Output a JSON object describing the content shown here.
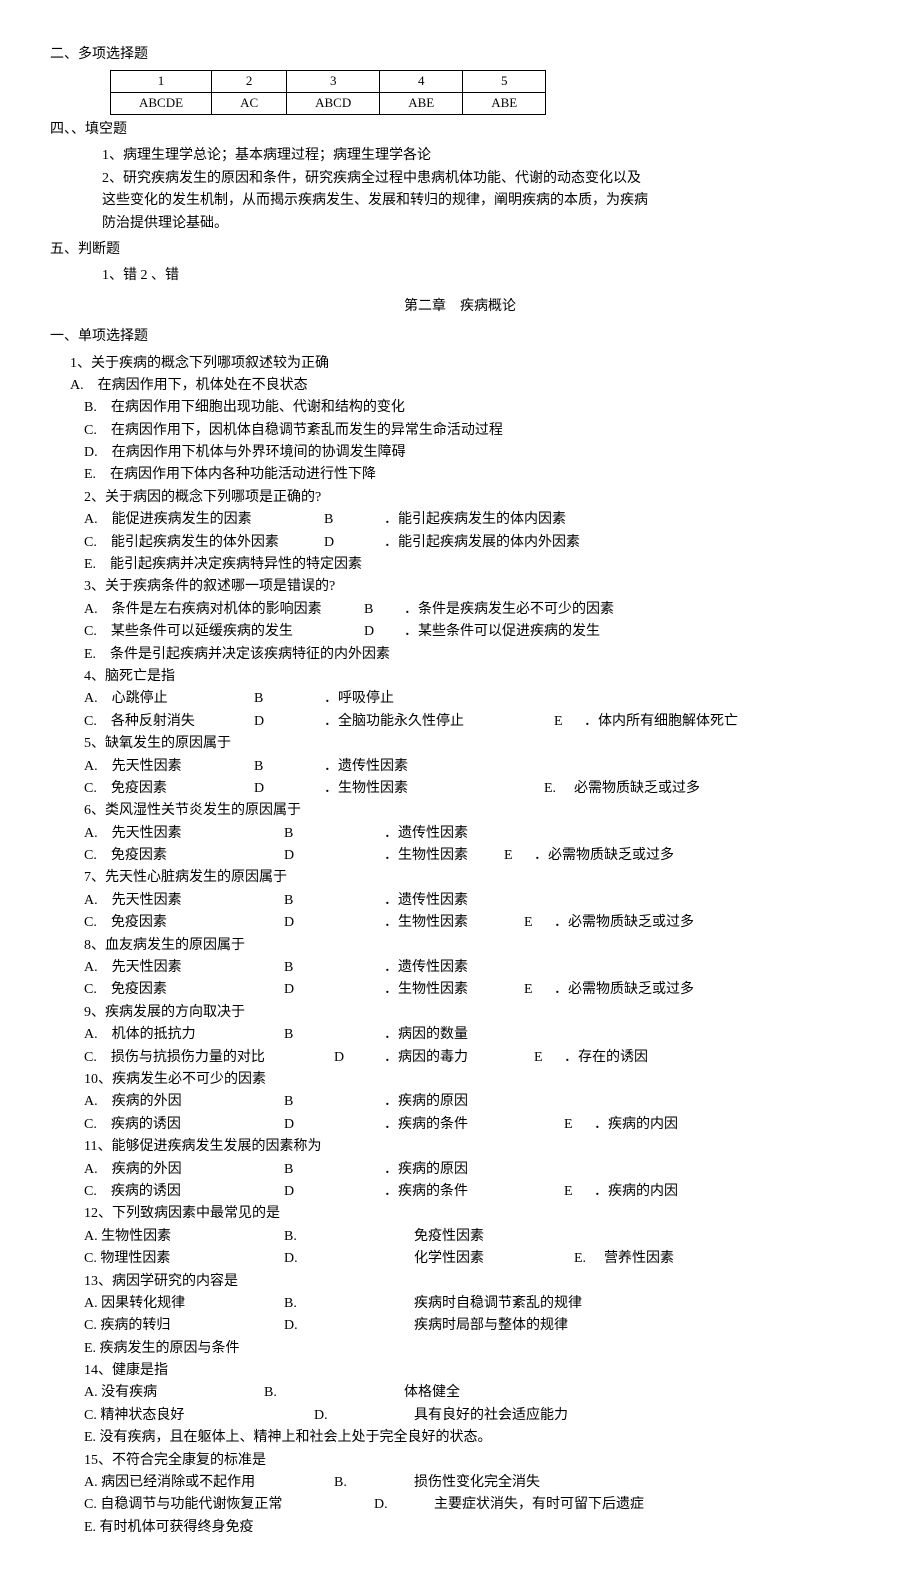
{
  "sec2_title": "二、多项选择题",
  "table": {
    "h": [
      "1",
      "2",
      "3",
      "4",
      "5"
    ],
    "r": [
      "ABCDE",
      "AC",
      "ABCD",
      "ABE",
      "ABE"
    ]
  },
  "sec4_title": "四、、填空题",
  "fill1": "1、病理生理学总论；基本病理过程；病理生理学各论",
  "fill2a": "2、研究疾病发生的原因和条件，研究疾病全过程中患病机体功能、代谢的动态变化以及",
  "fill2b": "这些变化的发生机制，从而揭示疾病发生、发展和转归的规律，阐明疾病的本质，为疾病",
  "fill2c": "防治提供理论基础。",
  "sec5_title": "五、判断题",
  "judge": "1、错  2 、错",
  "chapter": "第二章　疾病概论",
  "sec1_title": "一、单项选择题",
  "q1": {
    "stem": "1、关于疾病的概念下列哪项叙述较为正确",
    "A": "A.　在病因作用下，机体处在不良状态",
    "B": "B.　在病因作用下细胞出现功能、代谢和结构的变化",
    "C": "C.　在病因作用下，因机体自稳调节紊乱而发生的异常生命活动过程",
    "D": "D.　在病因作用下机体与外界环境间的协调发生障碍",
    "E": "E.　在病因作用下体内各种功能活动进行性下降"
  },
  "q2": {
    "stem": "2、关于病因的概念下列哪项是正确的?",
    "A": "A.　能促进疾病发生的因素",
    "Blabel": "B",
    "B": "．能引起疾病发生的体内因素",
    "C": "C.　能引起疾病发生的体外因素",
    "Dlabel": "D",
    "D": "．能引起疾病发展的体内外因素",
    "E": "E.　能引起疾病并决定疾病特异性的特定因素"
  },
  "q3": {
    "stem": "3、关于疾病条件的叙述哪一项是错误的?",
    "A": "A.　条件是左右疾病对机体的影响因素",
    "Blabel": "B",
    "B": "．条件是疾病发生必不可少的因素",
    "C": "C.　某些条件可以延缓疾病的发生",
    "Dlabel": "D",
    "D": "．某些条件可以促进疾病的发生",
    "E": "E.　条件是引起疾病并决定该疾病特征的内外因素"
  },
  "q4": {
    "stem": "4、脑死亡是指",
    "A": "A.　心跳停止",
    "Bl": "B",
    "B": "．呼吸停止",
    "C": "C.　各种反射消失",
    "Dl": "D",
    "D": "．全脑功能永久性停止",
    "El": "E",
    "E": "．体内所有细胞解体死亡"
  },
  "q5": {
    "stem": "5、缺氧发生的原因属于",
    "A": "A.　先天性因素",
    "Bl": "B",
    "B": "．遗传性因素",
    "C": "C.　免疫因素",
    "Dl": "D",
    "D": "．生物性因素",
    "El": "E.",
    "E": "必需物质缺乏或过多"
  },
  "q6": {
    "stem": "6、类风湿性关节炎发生的原因属于",
    "A": "A.　先天性因素",
    "Bl": "B",
    "B": "．遗传性因素",
    "C": "C.　免疫因素",
    "Dl": "D",
    "D": "．生物性因素",
    "El": "E",
    "E": "．必需物质缺乏或过多"
  },
  "q7": {
    "stem": "7、先天性心脏病发生的原因属于",
    "A": "A.　先天性因素",
    "Bl": "B",
    "B": "．遗传性因素",
    "C": "C.　免疫因素",
    "Dl": "D",
    "D": "．生物性因素",
    "El": "E",
    "E": "．必需物质缺乏或过多"
  },
  "q8": {
    "stem": "8、血友病发生的原因属于",
    "A": "A.　先天性因素",
    "Bl": "B",
    "B": "．遗传性因素",
    "C": "C.　免疫因素",
    "Dl": "D",
    "D": "．生物性因素",
    "El": "E",
    "E": "．必需物质缺乏或过多"
  },
  "q9": {
    "stem": "9、疾病发展的方向取决于",
    "A": "A.　机体的抵抗力",
    "Bl": "B",
    "B": "．病因的数量",
    "C": "C.　损伤与抗损伤力量的对比",
    "Dl": "D",
    "D": "．病因的毒力",
    "El": "E",
    "E": "．存在的诱因"
  },
  "q10": {
    "stem": "10、疾病发生必不可少的因素",
    "A": "A.　疾病的外因",
    "Bl": "B",
    "B": "．疾病的原因",
    "C": "C.　疾病的诱因",
    "Dl": "D",
    "D": "．疾病的条件",
    "El": "E",
    "E": "．疾病的内因"
  },
  "q11": {
    "stem": "11、能够促进疾病发生发展的因素称为",
    "A": "A.　疾病的外因",
    "Bl": "B",
    "B": "．疾病的原因",
    "C": "C.　疾病的诱因",
    "Dl": "D",
    "D": "．疾病的条件",
    "El": "E",
    "E": "．疾病的内因"
  },
  "q12": {
    "stem": "12、下列致病因素中最常见的是",
    "A": "A. 生物性因素",
    "Bl": "B.",
    "B": "免疫性因素",
    "C": "C. 物理性因素",
    "Dl": "D.",
    "D": "化学性因素",
    "El": "E.",
    "E": "营养性因素"
  },
  "q13": {
    "stem": "13、病因学研究的内容是",
    "A": "A. 因果转化规律",
    "Bl": "B.",
    "B": "疾病时自稳调节紊乱的规律",
    "C": "C. 疾病的转归",
    "Dl": "D.",
    "D": "疾病时局部与整体的规律",
    "E": "E. 疾病发生的原因与条件"
  },
  "q14": {
    "stem": "14、健康是指",
    "A": "A. 没有疾病",
    "Bl": "B.",
    "B": "体格健全",
    "C": "C. 精神状态良好",
    "Dl": "D.",
    "D": "具有良好的社会适应能力",
    "E": "E. 没有疾病，且在躯体上、精神上和社会上处于完全良好的状态。"
  },
  "q15": {
    "stem": "15、不符合完全康复的标准是",
    "A": "A. 病因已经消除或不起作用",
    "Bl": "B.",
    "B": "损伤性变化完全消失",
    "C": "C. 自稳调节与功能代谢恢复正常",
    "Dl": "D.",
    "D": "主要症状消失，有时可留下后遗症",
    "E": "E. 有时机体可获得终身免疫"
  }
}
